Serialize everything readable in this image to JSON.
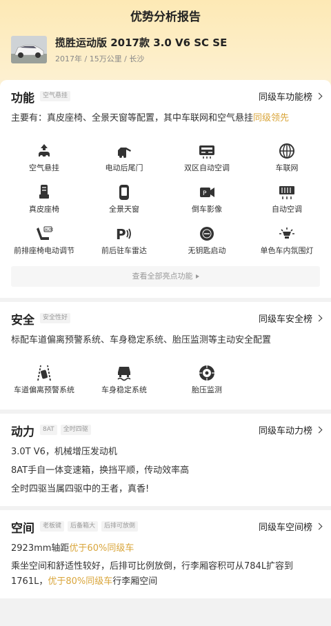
{
  "page": {
    "title": "优势分析报告"
  },
  "car": {
    "name": "揽胜运动版 2017款 3.0 V6 SC SE",
    "meta": "2017年 / 15万公里 / 长沙"
  },
  "function": {
    "title": "功能",
    "tags": [
      "空气悬挂"
    ],
    "rank_link": "同级车功能榜",
    "desc_prefix": "主要有：真皮座椅、全景天窗等配置，其中车联网和空气悬挂",
    "desc_highlight": "同级领先",
    "features": [
      {
        "label": "空气悬挂",
        "icon": "air-suspension-icon"
      },
      {
        "label": "电动后尾门",
        "icon": "power-tailgate-icon"
      },
      {
        "label": "双区自动空调",
        "icon": "dual-zone-ac-icon"
      },
      {
        "label": "车联网",
        "icon": "connected-car-icon"
      },
      {
        "label": "真皮座椅",
        "icon": "leather-seat-icon"
      },
      {
        "label": "全景天窗",
        "icon": "panoramic-sunroof-icon"
      },
      {
        "label": "倒车影像",
        "icon": "reverse-camera-icon"
      },
      {
        "label": "自动空调",
        "icon": "auto-ac-icon"
      },
      {
        "label": "前排座椅电动调节",
        "icon": "power-seat-icon"
      },
      {
        "label": "前后驻车雷达",
        "icon": "parking-radar-icon"
      },
      {
        "label": "无钥匙启动",
        "icon": "keyless-start-icon"
      },
      {
        "label": "单色车内氛围灯",
        "icon": "ambient-light-icon"
      }
    ],
    "see_all": "查看全部亮点功能"
  },
  "safety": {
    "title": "安全",
    "tags": [
      "安全性好"
    ],
    "rank_link": "同级车安全榜",
    "desc": "标配车道偏离预警系统、车身稳定系统、胎压监测等主动安全配置",
    "features": [
      {
        "label": "车道偏离预警系统",
        "icon": "lane-departure-icon"
      },
      {
        "label": "车身稳定系统",
        "icon": "stability-control-icon"
      },
      {
        "label": "胎压监测",
        "icon": "tire-pressure-icon"
      }
    ]
  },
  "power": {
    "title": "动力",
    "tags": [
      "8AT",
      "全时四驱"
    ],
    "rank_link": "同级车动力榜",
    "lines": [
      "3.0T V6，机械增压发动机",
      "8AT手自一体变速箱，换挡平顺，传动效率高",
      "全时四驱当属四驱中的王者，真香!"
    ]
  },
  "space": {
    "title": "空间",
    "tags": [
      "老板键",
      "后备箱大",
      "后排可放倒"
    ],
    "rank_link": "同级车空间榜",
    "line1_prefix": "2923mm轴距",
    "line1_highlight": "优于60%同级车",
    "line2_line1": "乘坐空间和舒适性较好，后排可比例放倒，行李厢容积可从784L扩容到",
    "line2_prefix": "1761L，",
    "line2_highlight": "优于80%同级车",
    "line2_suffix": "行李厢空间"
  },
  "colors": {
    "highlight": "#d9a53a",
    "header_bg": "#fde9b5"
  }
}
